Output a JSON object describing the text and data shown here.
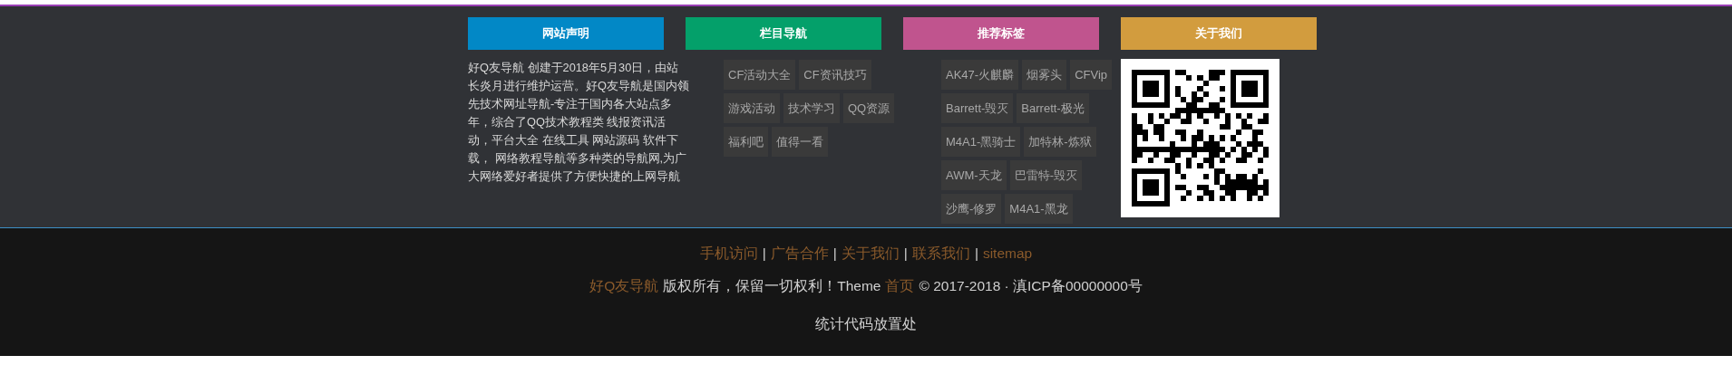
{
  "columns": [
    {
      "kind": "text",
      "title": "网站声明",
      "color": "#0288c6",
      "text": "好Q友导航 创建于2018年5月30日，由站长炎月进行维护运营。好Q友导航是国内领先技术网址导航-专注于国内各大站点多年，综合了QQ技术教程类 线报资讯活动，平台大全 在线工具 网站源码 软件下载， 网络教程导航等多种类的导航网,为广大网络爱好者提供了方便快捷的上网导航"
    },
    {
      "kind": "tags",
      "title": "栏目导航",
      "color": "#04a06a",
      "rows": [
        [
          "CF活动大全",
          "CF资讯技巧"
        ],
        [
          "游戏活动",
          "技术学习",
          "QQ资源"
        ],
        [
          "福利吧",
          "值得一看"
        ]
      ]
    },
    {
      "kind": "tags",
      "title": "推荐标签",
      "color": "#c0548e",
      "rows": [
        [
          "AK47-火麒麟",
          "烟雾头",
          "CFVip"
        ],
        [
          "Barrett-毁灭",
          "Barrett-极光"
        ],
        [
          "M4A1-黑骑士",
          "加特林-炼狱"
        ],
        [
          "AWM-天龙",
          "巴雷特-毁灭"
        ],
        [
          "沙鹰-修罗",
          "M4A1-黑龙"
        ]
      ]
    },
    {
      "kind": "qr",
      "title": "关于我们",
      "color": "#d29c3e"
    }
  ],
  "footer": {
    "links": [
      "手机访问",
      "广告合作",
      "关于我们",
      "联系我们",
      "sitemap"
    ],
    "separators": [
      "|",
      "|",
      "|",
      "|"
    ],
    "copyright": [
      {
        "kind": "link",
        "text": "好Q友导航"
      },
      {
        "kind": "text",
        "text": "版权所有，保留一切权利！Theme"
      },
      {
        "kind": "link",
        "text": "首页"
      },
      {
        "kind": "text",
        "text": "© 2017-2018 · 滇ICP备00000000号"
      }
    ],
    "stats": "统计代码放置处"
  }
}
